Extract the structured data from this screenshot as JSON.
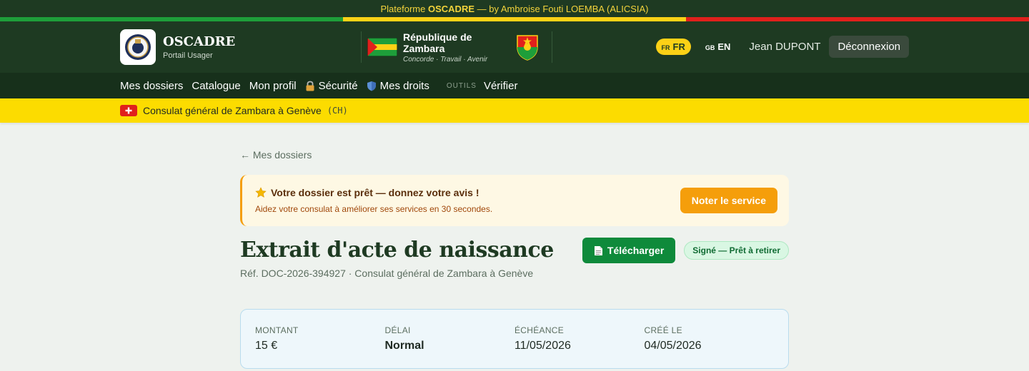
{
  "topbar": {
    "prefix": "Plateforme",
    "platform": "OSCADRE",
    "suffix": "— by Ambroise Fouti LOEMBA (ALICSIA)"
  },
  "colors": {
    "green": "#1e9e3a",
    "yellow": "#fcd116",
    "red": "#e0201c",
    "header_bg": "#1e3a22",
    "accent": "#f59e0b"
  },
  "brand": {
    "name": "OSCADRE",
    "subtitle": "Portail Usager"
  },
  "republic": {
    "name": "République de Zambara",
    "motto": "Concorde · Travail · Avenir"
  },
  "header": {
    "languages": [
      {
        "code": "FR",
        "label": "FR",
        "active": true
      },
      {
        "code": "GB",
        "label": "EN",
        "active": false
      }
    ],
    "user": "Jean DUPONT",
    "logout_label": "Déconnexion"
  },
  "nav": {
    "items": [
      {
        "label": "Mes dossiers"
      },
      {
        "label": "Catalogue"
      },
      {
        "label": "Mon profil"
      },
      {
        "label": "Sécurité",
        "icon": "lock-icon"
      },
      {
        "label": "Mes droits",
        "icon": "shield-icon"
      }
    ],
    "tools_label": "OUTILS",
    "tools_items": [
      {
        "label": "Vérifier"
      }
    ]
  },
  "consulate": {
    "name": "Consulat général de Zambara à Genève",
    "code": "(CH)",
    "flag_icon": "swiss-flag-icon"
  },
  "main": {
    "back_label": "← Mes dossiers",
    "notice": {
      "title": "Votre dossier est prêt — donnez votre avis !",
      "subtitle": "Aidez votre consulat à améliorer ses services en 30 secondes.",
      "button": "Noter le service",
      "icon": "star-icon"
    },
    "document": {
      "title": "Extrait d'acte de naissance",
      "ref": "Réf. DOC-2026-394927 · Consulat général de Zambara à Genève",
      "download_label": "Télécharger",
      "status": "Signé — Prêt à retirer"
    },
    "summary": [
      {
        "label": "MONTANT",
        "value": "15 €",
        "bold": false
      },
      {
        "label": "DÉLAI",
        "value": "Normal",
        "bold": true
      },
      {
        "label": "ÉCHÉANCE",
        "value": "11/05/2026",
        "bold": false
      },
      {
        "label": "CRÉÉ LE",
        "value": "04/05/2026",
        "bold": false
      }
    ]
  }
}
